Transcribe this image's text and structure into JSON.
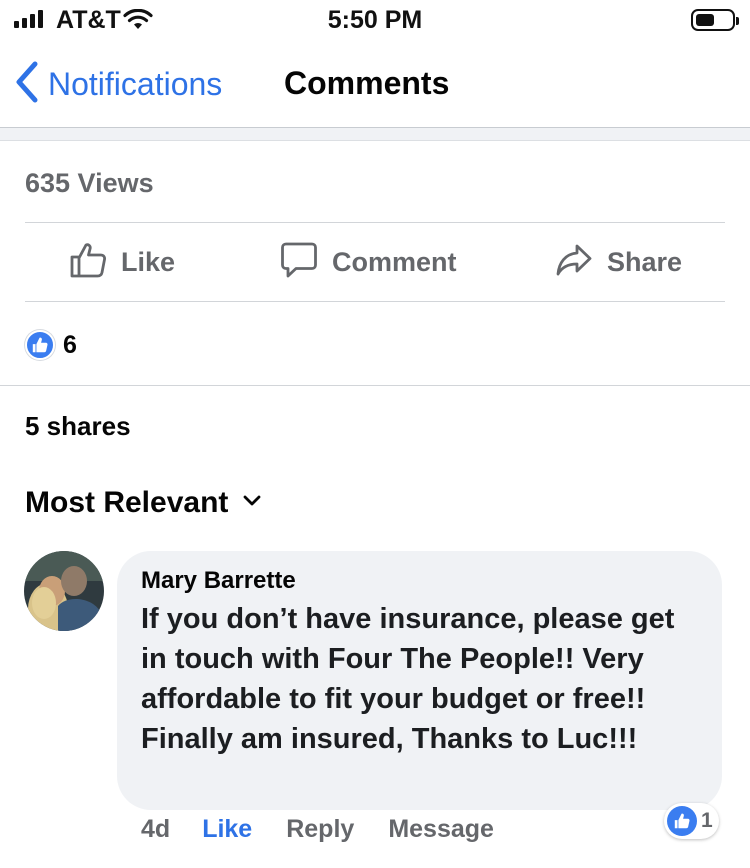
{
  "status_bar": {
    "carrier": "AT&T",
    "time": "5:50 PM"
  },
  "nav": {
    "back_label": "Notifications",
    "title": "Comments"
  },
  "post": {
    "views": "635 Views",
    "actions": {
      "like": "Like",
      "comment": "Comment",
      "share": "Share"
    },
    "reaction_count": "6",
    "shares": "5 shares"
  },
  "sort": {
    "label": "Most Relevant"
  },
  "comment": {
    "author": "Mary Barrette",
    "text": "If you don’t have insurance, please get in touch with Four The People!! Very affordable to fit your budget or free!! Finally am insured, Thanks to Luc!!!",
    "time": "4d",
    "actions": {
      "like": "Like",
      "reply": "Reply",
      "message": "Message"
    },
    "reaction_count": "1"
  },
  "colors": {
    "accent": "#2e72e6",
    "secondary_text": "#65676b",
    "bubble_bg": "#f0f2f5",
    "like_blue": "#3a7df0"
  }
}
